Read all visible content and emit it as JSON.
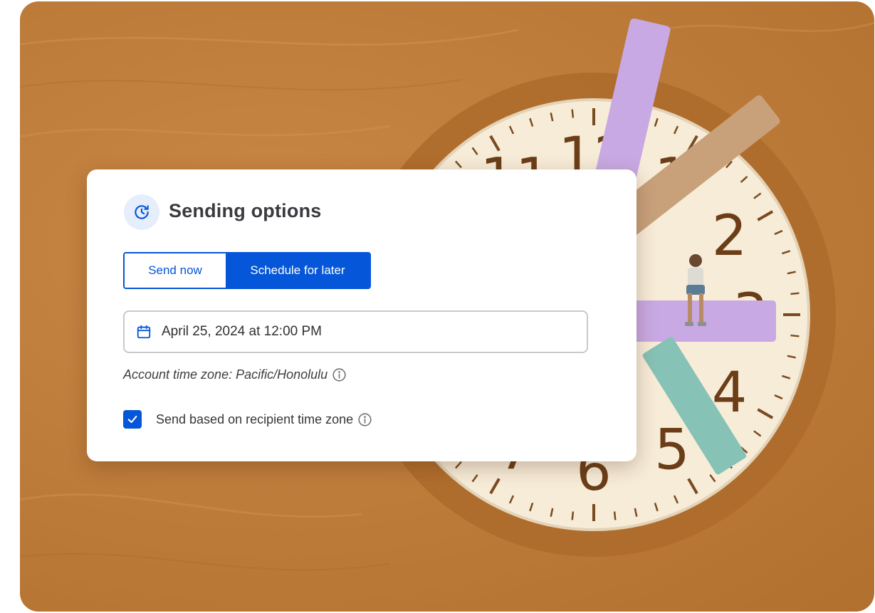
{
  "dialog": {
    "title": "Sending options",
    "icon": "clock-refresh-icon",
    "tabs": [
      {
        "label": "Send now",
        "selected": false
      },
      {
        "label": "Schedule for later",
        "selected": true
      }
    ],
    "date_field": {
      "value": "April 25, 2024 at 12:00 PM",
      "icon": "calendar-icon"
    },
    "timezone_note": "Account time zone: Pacific/Honolulu",
    "recipient_timezone": {
      "label": "Send based on recipient time zone",
      "checked": true
    }
  },
  "illustration": {
    "clock_numbers": [
      "12",
      "1",
      "2",
      "3",
      "4",
      "5",
      "6",
      "7",
      "11"
    ]
  },
  "colors": {
    "accent": "#0556d8",
    "background": "#bf7d3c",
    "clock_face": "#f7ecd8",
    "hand_purple": "#c8a9e3",
    "hand_tan": "#c8a17b",
    "hand_teal": "#86c2b5"
  }
}
